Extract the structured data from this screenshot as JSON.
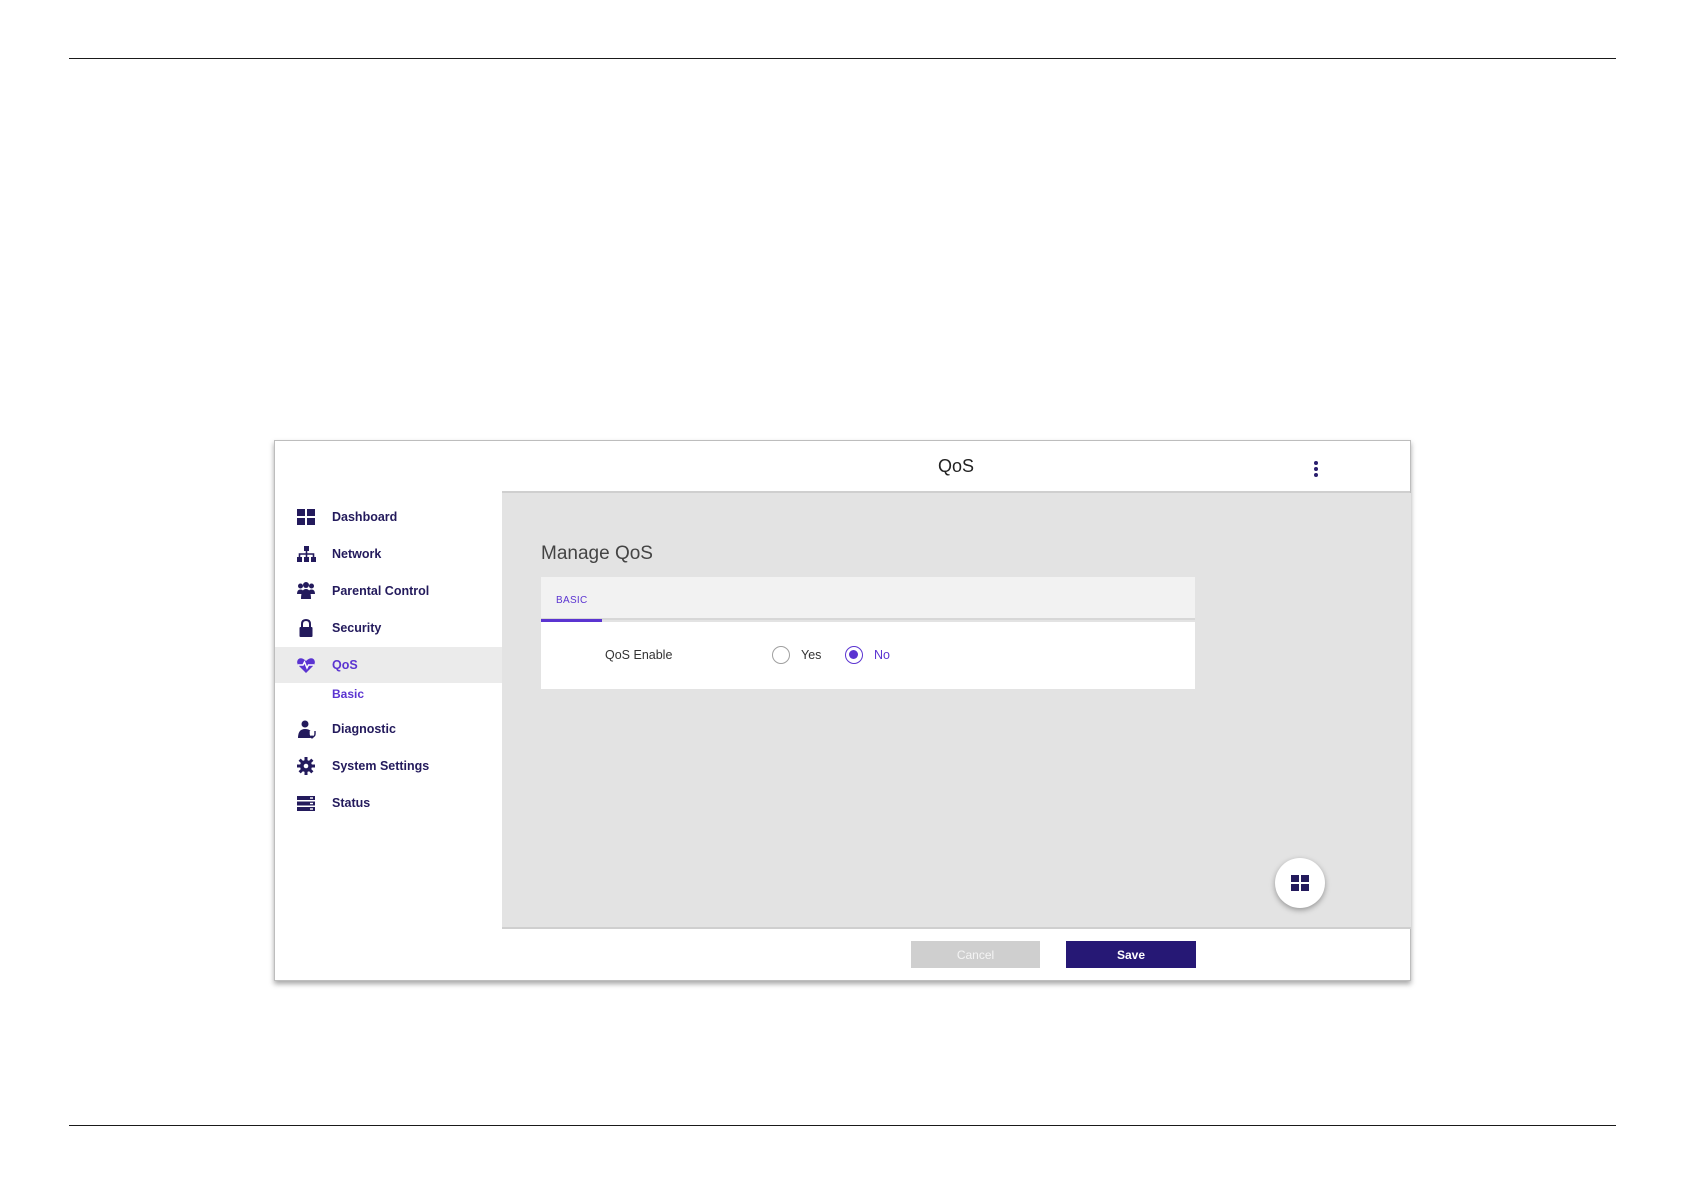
{
  "header": {
    "title": "QoS"
  },
  "sidebar": {
    "items": [
      {
        "label": "Dashboard"
      },
      {
        "label": "Network"
      },
      {
        "label": "Parental Control"
      },
      {
        "label": "Security"
      },
      {
        "label": "QoS"
      },
      {
        "label": "Diagnostic"
      },
      {
        "label": "System Settings"
      },
      {
        "label": "Status"
      }
    ],
    "qos_sub": {
      "label": "Basic"
    }
  },
  "main": {
    "section_title": "Manage QoS",
    "tabs": [
      {
        "label": "BASIC"
      }
    ],
    "qos_enable": {
      "label": "QoS Enable",
      "options": [
        {
          "label": "Yes"
        },
        {
          "label": "No"
        }
      ],
      "selected": "No"
    }
  },
  "footer": {
    "cancel_label": "Cancel",
    "save_label": "Save"
  },
  "colors": {
    "accent": "#5b34d1",
    "navy": "#261875",
    "content_bg": "#e3e3e3"
  }
}
